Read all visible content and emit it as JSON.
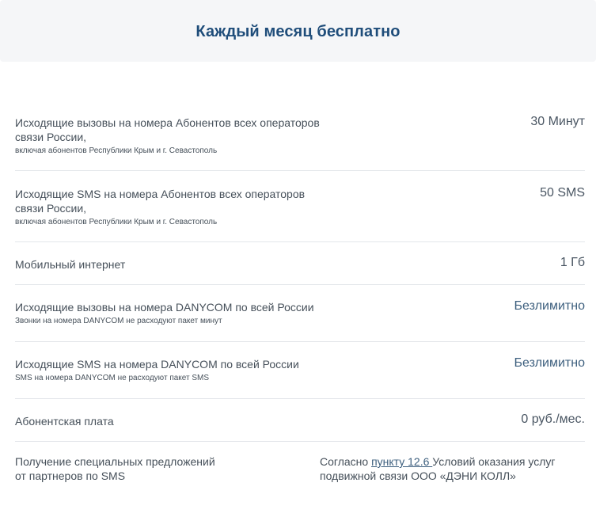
{
  "header": {
    "title": "Каждый месяц бесплатно"
  },
  "rows": [
    {
      "label": "Исходящие вызовы на номера Абонентов всех операторов связи России,",
      "note": "включая абонентов Республики Крым и г. Севастополь",
      "value": "30 Минут"
    },
    {
      "label": "Исходящие SMS на номера Абонентов всех операторов связи России,",
      "note": "включая абонентов Республики Крым и г. Севастополь",
      "value": "50 SMS"
    },
    {
      "label": "Мобильный интернет",
      "value": "1 Гб"
    },
    {
      "label": "Исходящие вызовы на номера DANYCOM по всей России",
      "note": "Звонки на номера DANYCOM не расходуют пакет минут",
      "value": "Безлимитно"
    },
    {
      "label": "Исходящие SMS на номера DANYCOM по всей России",
      "note": "SMS на номера DANYCOM не расходуют пакет SMS",
      "value": "Безлимитно"
    },
    {
      "label": "Абонентская плата",
      "value": "0 руб./мес."
    },
    {
      "label": "Получение специальных предложений от партнеров по SMS",
      "value_prefix": "Согласно ",
      "value_link": "пункту 12.6 ",
      "value_suffix": "Условий оказания услуг подвижной связи ООО «ДЭНИ КОЛЛ»"
    }
  ]
}
